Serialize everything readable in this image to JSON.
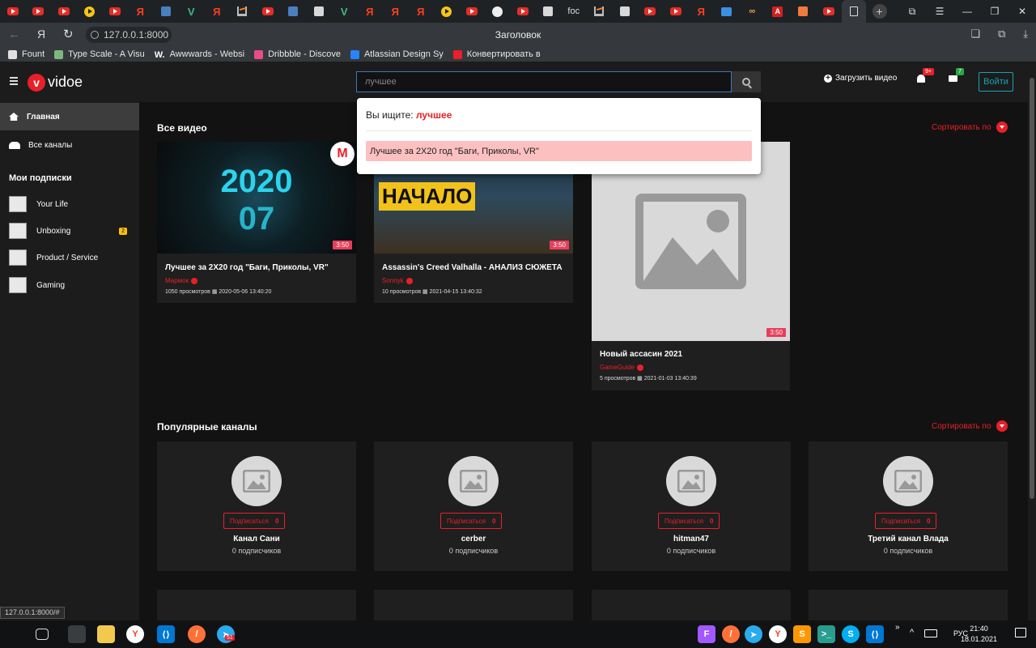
{
  "browser": {
    "tabs": [
      "youtube",
      "youtube",
      "youtube",
      "play",
      "youtube",
      "yandex",
      "sq-blue",
      "vue",
      "yandex",
      "stackoverflow",
      "youtube",
      "sq-blue",
      "sq-white",
      "vue",
      "yandex",
      "yandex",
      "yandex",
      "play",
      "youtube",
      "github",
      "youtube",
      "sq-white",
      "text",
      "stackoverflow",
      "sq-white",
      "youtube",
      "youtube",
      "yandex",
      "chat",
      "link",
      "a",
      "sq-orange",
      "youtube"
    ],
    "tab_text": "foc",
    "url": "127.0.0.1:8000",
    "title": "Заголовок",
    "yandex_glyph": "Я",
    "bookmarks": [
      {
        "label": "Fount",
        "color": "#e0e0e0"
      },
      {
        "label": "Type Scale - A Visu",
        "color": "#7cb87c"
      },
      {
        "label": "Awwwards - Websi",
        "color": "#ffffff",
        "prefix": "W."
      },
      {
        "label": "Dribbble - Discove",
        "color": "#ea4c89"
      },
      {
        "label": "Atlassian Design Sy",
        "color": "#2684ff"
      },
      {
        "label": "Конвертировать в",
        "color": "#e8202a"
      }
    ]
  },
  "header": {
    "logo_letter": "v",
    "logo_text": "vidoe",
    "search_value": "лучшее",
    "upload_label": "Загрузить видео",
    "notif_count": "9+",
    "mail_count": "7",
    "login_label": "Войти"
  },
  "search_dropdown": {
    "prefix": "Вы ищите: ",
    "query": "лучшее",
    "results": [
      "Лучшее за 2X20 год \"Баги, Приколы, VR\""
    ]
  },
  "sidebar": {
    "items": [
      {
        "label": "Главная",
        "icon": "home-icon"
      },
      {
        "label": "Все каналы",
        "icon": "users-icon"
      }
    ],
    "subs_heading": "Мои подписки",
    "subs": [
      {
        "label": "Your Life",
        "badge": ""
      },
      {
        "label": "Unboxing",
        "badge": "2"
      },
      {
        "label": "Product / Service",
        "badge": ""
      },
      {
        "label": "Gaming",
        "badge": ""
      }
    ]
  },
  "videos_section": {
    "title": "Все видео",
    "sort_label": "Сортировать по",
    "videos": [
      {
        "title": "Лучшее за 2X20 год \"Баги, Приколы, VR\"",
        "channel": "Мармок",
        "views": "1050 просмотров",
        "date": "2020-05-06 13:40:20",
        "duration": "3:50",
        "thumb_text": "2020"
      },
      {
        "title": "Assassin's Creed Valhalla - АНАЛИЗ СЮЖЕТА",
        "channel": "Sonnyk",
        "views": "10 просмотров",
        "date": "2021-04-15 13:40:32",
        "duration": "3:50",
        "thumb_text": "НАЧАЛО"
      },
      {
        "title": "Новый ассасин 2021",
        "channel": "GameGuide",
        "views": "5 просмотров",
        "date": "2021-01-03 13:40:39",
        "duration": "3:50"
      }
    ]
  },
  "channels_section": {
    "title": "Популярные каналы",
    "sort_label": "Сортировать по",
    "subscribe_label": "Подписаться",
    "channels": [
      {
        "name": "Канал Сани",
        "subscribers": "0 подписчиков",
        "count": "0"
      },
      {
        "name": "cerber",
        "subscribers": "0 подписчиков",
        "count": "0"
      },
      {
        "name": "hitman47",
        "subscribers": "0 подписчиков",
        "count": "0"
      },
      {
        "name": "Третий канал Влада",
        "subscribers": "0 подписчиков",
        "count": "0"
      }
    ]
  },
  "status_url": "127.0.0.1:8000/#",
  "taskbar": {
    "lang": "РУС",
    "time": "21:40",
    "date": "18.01.2021",
    "telegram_badge": "51"
  }
}
